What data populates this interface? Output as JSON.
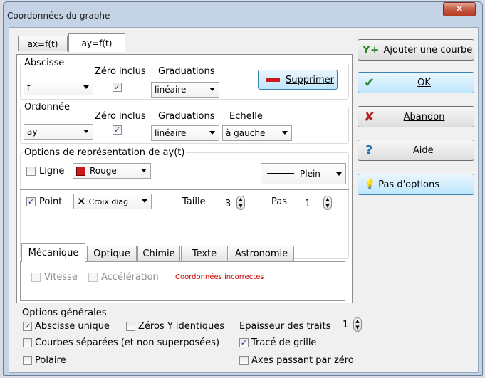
{
  "window": {
    "title": "Coordonnées du graphe",
    "close": "✕"
  },
  "tabs": [
    "ax=f(t)",
    "ay=f(t)"
  ],
  "abscisse": {
    "label": "Abscisse",
    "zero_label": "Zéro inclus",
    "grad_label": "Graduations",
    "var_value": "t",
    "grad_value": "linéaire",
    "zero_checked": "✓",
    "delete_button": "Supprimer"
  },
  "ordonnee": {
    "label": "Ordonnée",
    "zero_label": "Zéro inclus",
    "grad_label": "Graduations",
    "scale_label": "Echelle",
    "var_value": "ay",
    "grad_value": "linéaire",
    "scale_value": "à gauche",
    "zero_checked": "✓"
  },
  "options": {
    "title": "Options de représentation de ay(t)",
    "line_label": "Ligne",
    "line_color": "Rouge",
    "line_style": "Plein",
    "point_label": "Point",
    "point_checked": "✓",
    "point_style": "Croix diag",
    "size_label": "Taille",
    "size_value": "3",
    "step_label": "Pas",
    "step_value": "1"
  },
  "subtabs": [
    "Mécanique",
    "Optique",
    "Chimie",
    "Texte",
    "Astronomie"
  ],
  "mechanics": {
    "speed": "Vitesse",
    "accel": "Accélération",
    "error": "Coordonnées incorrectes"
  },
  "buttons": {
    "add_curve": "Ajouter une courbe",
    "ok": "OK",
    "cancel": "Abandon",
    "help": "Aide",
    "no_options": "Pas d'options"
  },
  "general": {
    "title": "Options générales",
    "unique_abs": "Abscisse unique",
    "zeros_y": "Zéros Y identiques",
    "line_width_label": "Epaisseur des traits",
    "line_width_value": "1",
    "separate": "Courbes séparées (et non superposées)",
    "grid": "Tracé de grille",
    "polar": "Polaire",
    "axes_zero": "Axes passant par zéro",
    "checked": "✓"
  },
  "colors": {
    "accent_red": "#cc1a1a",
    "error_red": "#cc0000",
    "focus_blue": "#3c7fb1"
  }
}
